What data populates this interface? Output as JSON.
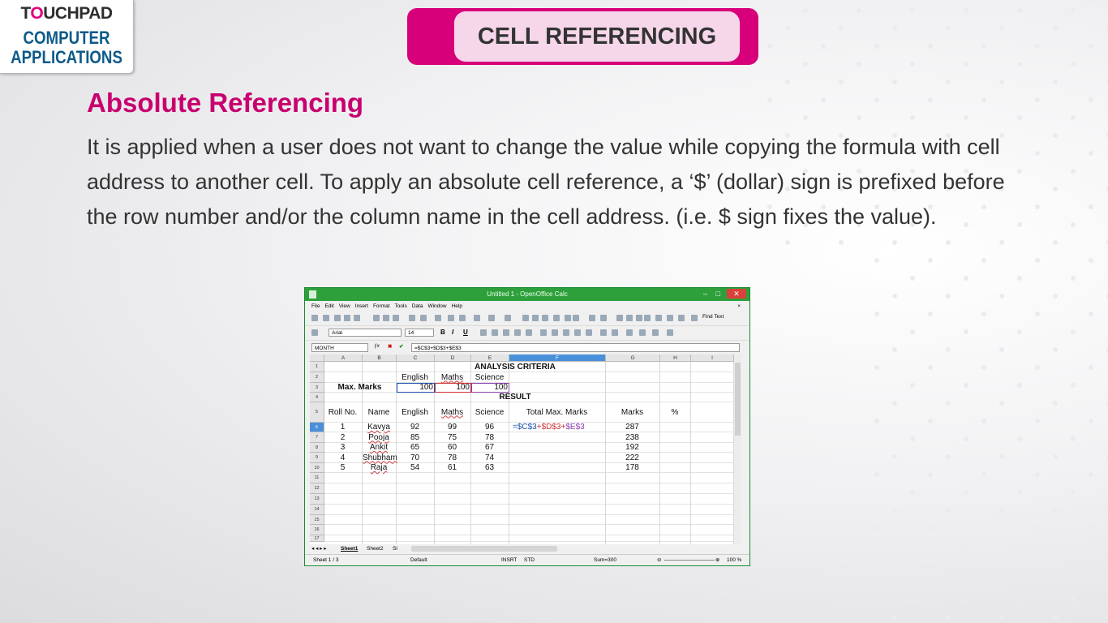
{
  "logo": {
    "brand_pre": "T",
    "brand_o": "O",
    "brand_post": "UCHPAD",
    "line1": "COMPUTER",
    "line2": "APPLICATIONS"
  },
  "header": {
    "title": "CELL REFERENCING"
  },
  "heading": "Absolute Referencing",
  "paragraph": "It is applied when a user does not want to change the value while copying the formula with cell address to another cell. To apply an absolute cell reference, a ‘$’ (dollar) sign is prefixed before the row number and/or the column name in the cell address. (i.e. $ sign fixes the value).",
  "calc": {
    "title": "Untitled 1 - OpenOffice Calc",
    "menu": [
      "File",
      "Edit",
      "View",
      "Insert",
      "Format",
      "Tools",
      "Data",
      "Window",
      "Help"
    ],
    "find_text": "Find Text",
    "font_name": "Arial",
    "font_size": "14",
    "name_box": "MONTH",
    "formula": "=$C$3+$D$3+$E$3",
    "columns": [
      "A",
      "B",
      "C",
      "D",
      "E",
      "F",
      "G",
      "H",
      "I"
    ],
    "rows": [
      "1",
      "2",
      "3",
      "4",
      "5",
      "6",
      "7",
      "8",
      "9",
      "10",
      "11",
      "12",
      "13",
      "14",
      "15",
      "16",
      "17"
    ],
    "cells": {
      "analysis": "ANALYSIS CRITERIA",
      "english": "English",
      "maths": "Maths",
      "science": "Science",
      "max_marks": "Max. Marks",
      "v100a": "100",
      "v100b": "100",
      "v100c": "100",
      "result": "RESULT",
      "h_roll": "Roll No.",
      "h_name": "Name",
      "h_english": "English",
      "h_maths": "Maths",
      "h_science": "Science",
      "h_total": "Total Max. Marks",
      "h_marks": "Marks",
      "h_pct": "%",
      "f1": "=$C$3",
      "f2": "+$D$3+",
      "f3": "$E$3"
    },
    "students": [
      {
        "roll": "1",
        "name": "Kavya",
        "english": "92",
        "maths": "99",
        "science": "96",
        "marks": "287"
      },
      {
        "roll": "2",
        "name": "Pooja",
        "english": "85",
        "maths": "75",
        "science": "78",
        "marks": "238"
      },
      {
        "roll": "3",
        "name": "Ankit",
        "english": "65",
        "maths": "60",
        "science": "67",
        "marks": "192"
      },
      {
        "roll": "4",
        "name": "Shubham",
        "english": "70",
        "maths": "78",
        "science": "74",
        "marks": "222"
      },
      {
        "roll": "5",
        "name": "Raja",
        "english": "54",
        "maths": "61",
        "science": "63",
        "marks": "178"
      }
    ],
    "sheets": [
      "Sheet1",
      "Sheet2",
      "Sl"
    ],
    "status": {
      "sheet": "Sheet 1 / 3",
      "style": "Default",
      "mode": "INSRT",
      "sel": "STD",
      "sum": "Sum=300",
      "zoom": "100 %"
    }
  },
  "colors": {
    "accent": "#d8007a",
    "heading": "#c8006f",
    "calc_title": "#2ea03b",
    "formula_c": "#1a4fb0",
    "formula_d": "#d03030",
    "formula_e": "#8a3fb0"
  }
}
